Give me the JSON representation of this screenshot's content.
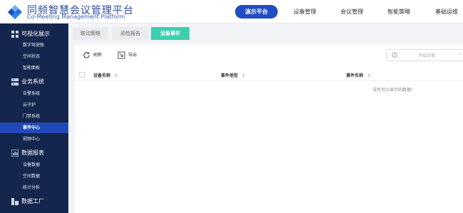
{
  "header": {
    "brand_cn": "同频智慧会议管理平台",
    "brand_en": "Co-Meeting Management Platform",
    "nav": [
      "演示平台",
      "设备管理",
      "会议管理",
      "智能策略",
      "基础运维"
    ]
  },
  "sidebar": {
    "groups": [
      {
        "label": "可视化展示",
        "icon": "grid-icon",
        "items": [
          "数字驾驶舱",
          "空间状态",
          "智能面板"
        ]
      },
      {
        "label": "业务系统",
        "icon": "server-icon",
        "items": [
          "告警系统",
          "云守护",
          "门禁系统",
          "事件中心",
          "视频中心"
        ]
      },
      {
        "label": "数据报表",
        "icon": "chart-icon",
        "items": [
          "设备数据",
          "空间数据",
          "统计分析"
        ]
      },
      {
        "label": "数据工厂",
        "icon": "factory-icon",
        "items": []
      }
    ],
    "active_item": "事件中心"
  },
  "tabs": [
    "联动策略",
    "巡检报告",
    "设备事件"
  ],
  "active_tab": "设备事件",
  "toolbar": {
    "refresh_label": "刷新",
    "export_label": "导出"
  },
  "filters": {
    "start_date_placeholder": "开始日期",
    "date_separator": "-"
  },
  "table": {
    "columns": [
      "设备名称",
      "事件类型",
      "事件名称"
    ],
    "empty_text": "没有可以显示的数据!"
  },
  "colors": {
    "sidebar_bg": "#14264d",
    "nav_active": "#1f4ec1",
    "tab_active": "#3ecfae",
    "sidebar_active": "#2149b8"
  }
}
